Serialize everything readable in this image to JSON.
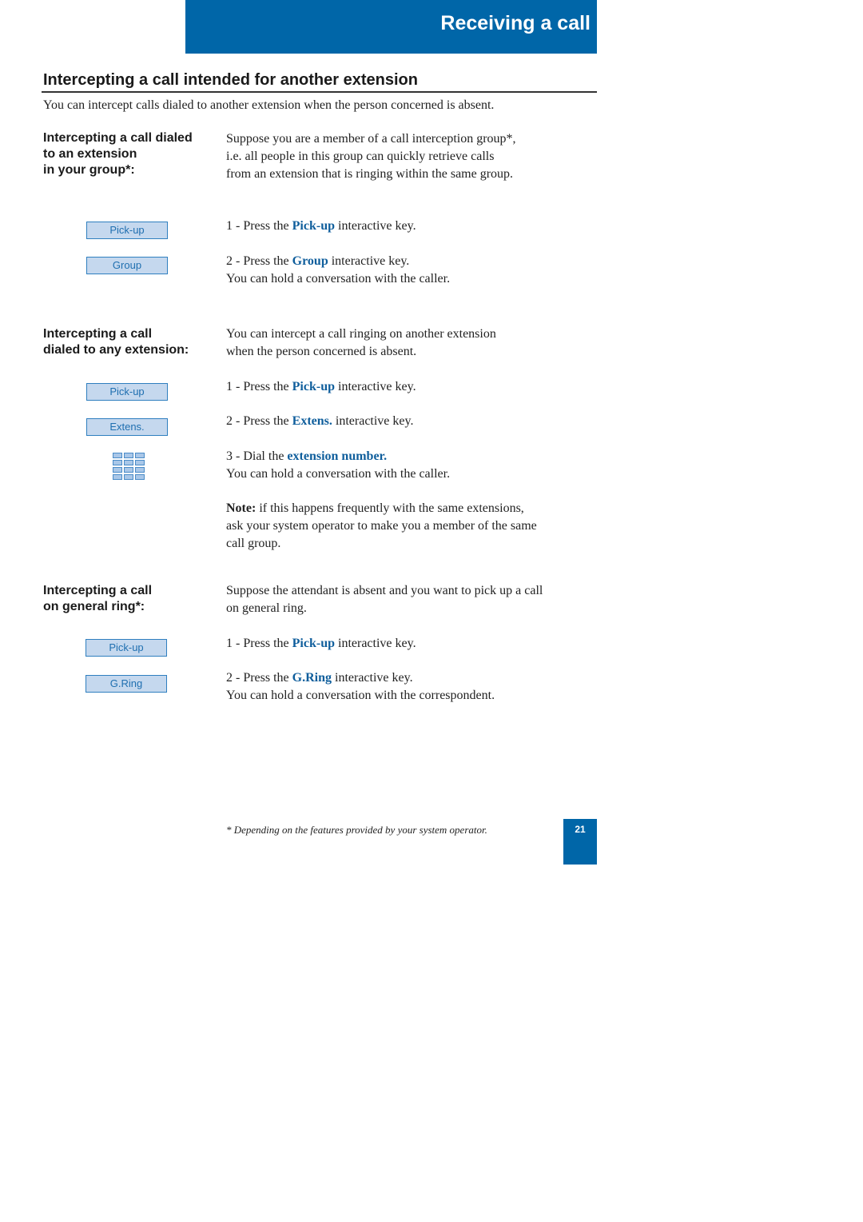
{
  "header": {
    "banner_title": "Receiving a call",
    "accent_color": "#0066a8"
  },
  "section": {
    "title": "Intercepting a call intended for another extension",
    "intro": "You can intercept calls dialed to another extension when the person concerned is absent."
  },
  "groups": [
    {
      "heading_lines": [
        "Intercepting a call dialed",
        "to an extension",
        "in your group*:"
      ],
      "description_lines": [
        "Suppose you are a member of a call interception group*,",
        "i.e. all people in this group can quickly retrieve calls",
        "from an extension that is ringing within the same group."
      ],
      "keys": [
        "Pick-up",
        "Group"
      ],
      "steps": [
        {
          "prefix": "1 - Press the ",
          "key": "Pick-up",
          "suffix": " interactive key."
        },
        {
          "prefix": "2 - Press the ",
          "key": "Group",
          "suffix": " interactive key."
        }
      ],
      "result": "You can hold a conversation with the caller."
    },
    {
      "heading_lines": [
        "Intercepting a call",
        "dialed to any extension:"
      ],
      "description_lines": [
        "You can intercept a call ringing on another extension",
        "when the person concerned is absent."
      ],
      "keys": [
        "Pick-up",
        "Extens."
      ],
      "keypad_icon": "keypad-icon",
      "steps": [
        {
          "prefix": "1 - Press the ",
          "key": "Pick-up",
          "suffix": " interactive key."
        },
        {
          "prefix": "2 - Press the ",
          "key": "Extens.",
          "suffix": " interactive key."
        },
        {
          "prefix": "3 - Dial the ",
          "key": "extension number.",
          "suffix": ""
        }
      ],
      "result": "You can hold a conversation with the caller.",
      "note": {
        "label": "Note:",
        "lines": [
          " if this happens frequently with the same extensions,",
          "ask your system operator to make you a member of the same",
          "call group."
        ]
      }
    },
    {
      "heading_lines": [
        "Intercepting a call",
        "on general ring*:"
      ],
      "description_lines": [
        "Suppose the attendant is absent and you want to pick up a call",
        "on general ring."
      ],
      "keys": [
        "Pick-up",
        "G.Ring"
      ],
      "steps": [
        {
          "prefix": "1 - Press the ",
          "key": "Pick-up",
          "suffix": " interactive key."
        },
        {
          "prefix": "2 - Press the ",
          "key": "G.Ring",
          "suffix": " interactive key."
        }
      ],
      "result": "You can hold a conversation with the correspondent."
    }
  ],
  "footer": {
    "footnote": "* Depending on the features provided by your system operator.",
    "page_number": "21"
  }
}
